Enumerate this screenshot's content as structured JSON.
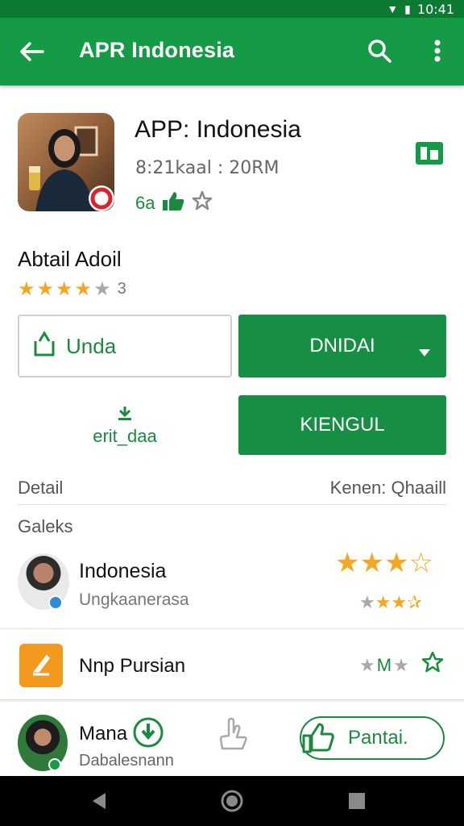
{
  "status_bar": {
    "time": "10:41"
  },
  "app_bar": {
    "title": "APR Indonesia"
  },
  "app": {
    "name": "APP: Indonesia",
    "meta": "8:21kaal : 20RM",
    "rating_label": "6a",
    "author": "Abtail Adoil",
    "rating_count": "3",
    "stars": {
      "filled": 4,
      "total": 5
    }
  },
  "actions": {
    "outline_button_label": "Unda",
    "primary_button_label": "DNIDAI",
    "secondary_text_label": "erit_daa",
    "secondary_button_label": "KIENGUL"
  },
  "details": {
    "left_label": "Detail",
    "right_label": "Kenen: Qhaaill",
    "section_label": "Galeks"
  },
  "list": [
    {
      "name": "Indonesia",
      "subtitle": "Ungkaanerasa",
      "big_stars": {
        "filled": 3,
        "total": 4
      }
    },
    {
      "name": "Nnp Pursian",
      "meta_letter": "M"
    }
  ],
  "bottom_card": {
    "name": "Mana",
    "subtitle": "Dabalesnann",
    "pill_label": "Pantai."
  },
  "colors": {
    "primary": "#159a45",
    "primary_dark": "#0d7a33",
    "star": "#f5a623",
    "orange_icon": "#f39a1e"
  },
  "icons": [
    "back-arrow-icon",
    "search-icon",
    "more-vert-icon",
    "bookmark-icon",
    "thumb-up-icon",
    "upload-icon",
    "chevron-down-icon",
    "download-icon",
    "star-icon",
    "hand-icon",
    "home-icon",
    "back-nav-icon",
    "recents-icon"
  ]
}
